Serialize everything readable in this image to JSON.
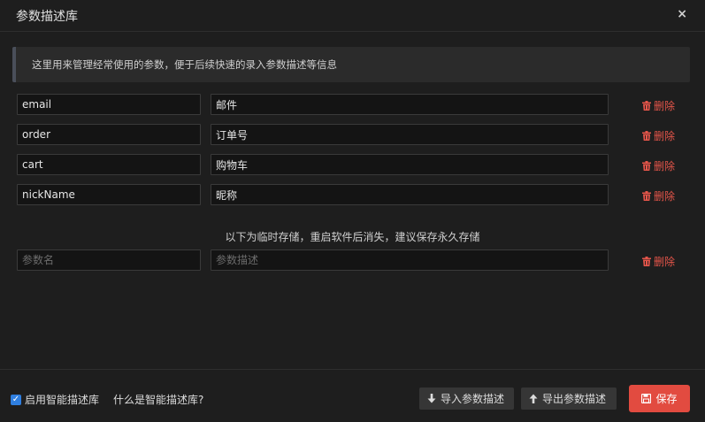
{
  "dialog": {
    "title": "参数描述库",
    "close_label": "×"
  },
  "notice": "这里用来管理经常使用的参数，便于后续快速的录入参数描述等信息",
  "params": [
    {
      "name": "email",
      "desc": "邮件"
    },
    {
      "name": "order",
      "desc": "订单号"
    },
    {
      "name": "cart",
      "desc": "购物车"
    },
    {
      "name": "nickName",
      "desc": "昵称"
    }
  ],
  "delete_label": "删除",
  "temp_note": "以下为临时存储，重启软件后消失，建议保存永久存储",
  "temp_row": {
    "name_placeholder": "参数名",
    "desc_placeholder": "参数描述"
  },
  "footer": {
    "enable_label": "启用智能描述库",
    "enable_checked": true,
    "what_label": "什么是智能描述库?",
    "import_label": "导入参数描述",
    "export_label": "导出参数描述",
    "save_label": "保存"
  },
  "colors": {
    "danger": "#e5554a",
    "primary": "#2f7fe0",
    "save": "#e24b40"
  }
}
